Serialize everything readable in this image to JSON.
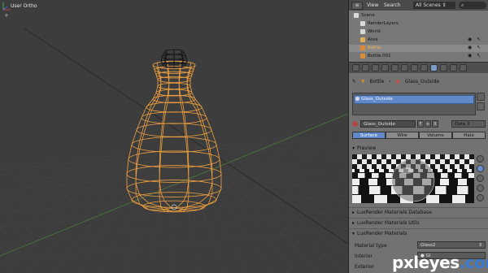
{
  "viewport": {
    "label": "User Ortho"
  },
  "header": {
    "editor_icon": "outliner-editor-icon",
    "menu": [
      "View",
      "Search"
    ],
    "scene_filter": "All Scenes",
    "search_placeholder": ""
  },
  "outliner": {
    "rows": [
      {
        "label": "Scene",
        "icon": "scene-icon",
        "indent": 0,
        "color": "#d9d9d9"
      },
      {
        "label": "RenderLayers",
        "icon": "renderlayers-icon",
        "indent": 1,
        "color": "#d9d9d9"
      },
      {
        "label": "World",
        "icon": "world-icon",
        "indent": 1,
        "color": "#d9d9d9"
      },
      {
        "label": "Area",
        "icon": "lamp-icon",
        "indent": 1,
        "color": "#e0b050"
      },
      {
        "label": "Bottle",
        "icon": "mesh-icon",
        "indent": 1,
        "color": "#e08a30",
        "selected": true
      },
      {
        "label": "Bottle.001",
        "icon": "mesh-icon",
        "indent": 1,
        "color": "#e08a30"
      }
    ]
  },
  "properties": {
    "breadcrumb": {
      "object": "Bottle",
      "material": "Glass_Outside"
    },
    "slot": "Glass_Outside",
    "material_name": "Glass_Outside",
    "material_buttons": [
      "F",
      "+",
      "X"
    ],
    "link": "Data",
    "modes": [
      {
        "label": "Surface",
        "active": true
      },
      {
        "label": "Wire",
        "active": false
      },
      {
        "label": "Volume",
        "active": false
      },
      {
        "label": "Halo",
        "active": false
      }
    ],
    "preview_header": "Preview",
    "panels": [
      "LuxRender Materials Database",
      "LuxRender Materials Utils",
      "LuxRender Materials"
    ],
    "material_type_label": "Material type",
    "material_type_value": "Glass2",
    "interior_label": "Interior",
    "interior_value": "Gl",
    "exterior_label": "Exterior"
  },
  "colors": {
    "accent": "#5f89c9",
    "wire_selected": "#f0a040",
    "wire_cap": "#111111"
  },
  "watermark": {
    "text_a": "pxl",
    "text_b": "eyes",
    "text_c": ".com"
  }
}
